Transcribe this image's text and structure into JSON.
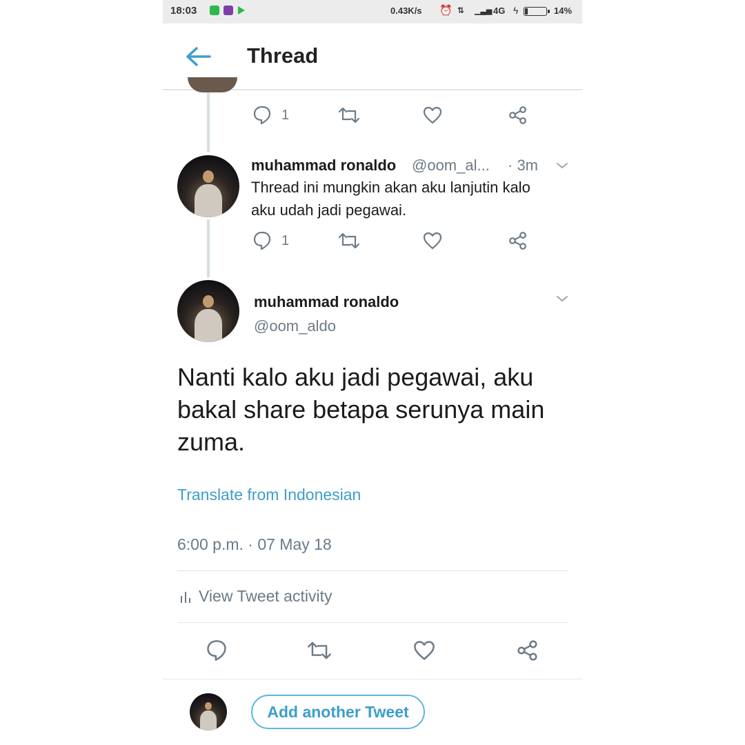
{
  "status_bar": {
    "time": "18:03",
    "speed": "0.43K/s",
    "alarm_icon": "alarm-icon",
    "network_icon": "data-arrows-icon",
    "signal_icon": "signal-bars-icon",
    "network_type": "4G",
    "battery_percent": "14%",
    "battery_level": 0.14
  },
  "header": {
    "back_icon": "arrow-left-icon",
    "title": "Thread"
  },
  "previous_tweet": {
    "reply_count": "1"
  },
  "reply_tweet": {
    "name": "muhammad ronaldo",
    "handle": "@oom_al...",
    "time": "· 3m",
    "text": "Thread  ini mungkin akan aku lanjutin kalo aku udah jadi pegawai.",
    "reply_count": "1"
  },
  "main_tweet": {
    "name": "muhammad ronaldo",
    "handle": "@oom_aldo",
    "text": "Nanti kalo aku jadi pegawai, aku bakal share betapa serunya main zuma.",
    "translate_label": "Translate from Indonesian",
    "timestamp": "6:00 p.m. · 07 May 18",
    "activity_label": "View Tweet activity"
  },
  "compose": {
    "button_label": "Add another Tweet"
  },
  "colors": {
    "accent": "#3d9ec9",
    "muted": "#6c7a86",
    "thread_line": "#d8dee3"
  }
}
